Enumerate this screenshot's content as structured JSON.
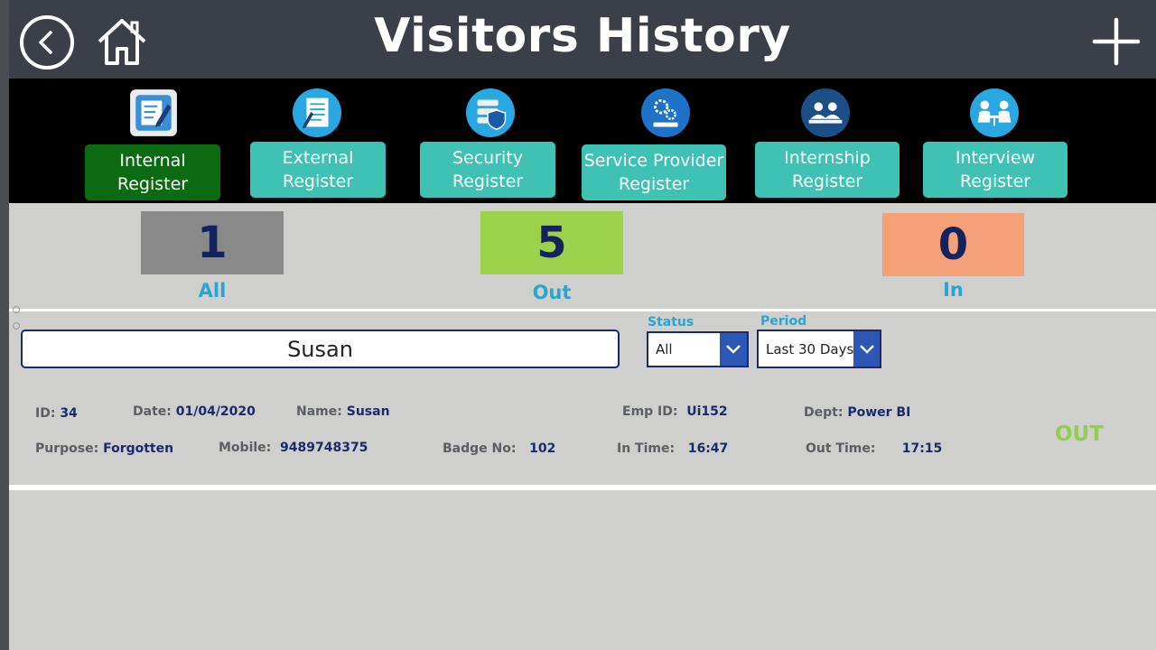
{
  "header": {
    "title": "Visitors History",
    "icons": {
      "back": "back-arrow-icon",
      "home": "home-icon",
      "add": "plus-icon"
    }
  },
  "registers": [
    {
      "label": "Internal Register",
      "icon": "edit-document-icon",
      "active": true
    },
    {
      "label": "External Register",
      "icon": "notepad-icon",
      "active": false
    },
    {
      "label": "Security Register",
      "icon": "security-server-icon",
      "active": false
    },
    {
      "label": "Service Provider Register",
      "icon": "services-gear-icon",
      "active": false
    },
    {
      "label": "Internship Register",
      "icon": "meeting-people-icon",
      "active": false
    },
    {
      "label": "Interview Register",
      "icon": "interview-icon",
      "active": false
    }
  ],
  "counters": {
    "all": {
      "value": "1",
      "label": "All",
      "color": "#898989"
    },
    "out": {
      "value": "5",
      "label": "Out",
      "color": "#9bd24a"
    },
    "in": {
      "value": "0",
      "label": "In",
      "color": "#f6a07a"
    }
  },
  "search": {
    "value": "Susan"
  },
  "filters": {
    "status": {
      "label": "Status",
      "selected": "All"
    },
    "period": {
      "label": "Period",
      "selected": "Last 30 Days"
    }
  },
  "record": {
    "id_label": "ID:",
    "id": "34",
    "date_label": "Date:",
    "date": "01/04/2020",
    "name_label": "Name:",
    "name": "Susan",
    "emp_label": "Emp ID:",
    "emp_id": "Ui152",
    "dept_label": "Dept:",
    "dept": "Power BI",
    "purpose_label": "Purpose:",
    "purpose": "Forgotten",
    "mobile_label": "Mobile:",
    "mobile": "9489748375",
    "badge_label": "Badge No:",
    "badge": "102",
    "in_label": "In Time:",
    "in_time": "16:47",
    "out_label": "Out Time:",
    "out_time": "17:15",
    "status": "OUT"
  },
  "colors": {
    "header_bg": "#3a3f48",
    "nav_button": "#3fc2b3",
    "nav_button_active": "#0b6b13",
    "accent_blue": "#28a6d2",
    "navy": "#13235e",
    "status_out": "#93cf4c"
  }
}
